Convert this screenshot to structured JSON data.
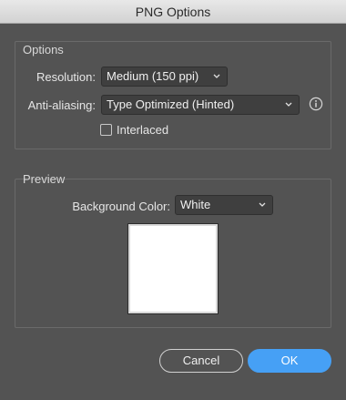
{
  "window": {
    "title": "PNG Options"
  },
  "options_group": {
    "title": "Options",
    "resolution": {
      "label": "Resolution:",
      "value": "Medium (150 ppi)"
    },
    "anti_aliasing": {
      "label": "Anti-aliasing:",
      "value": "Type Optimized (Hinted)"
    },
    "interlaced": {
      "label": "Interlaced",
      "checked": false
    },
    "info_icon": "info-circle-icon"
  },
  "preview_group": {
    "title": "Preview",
    "background_color": {
      "label": "Background Color:",
      "value": "White"
    },
    "swatch_color": "#ffffff"
  },
  "buttons": {
    "cancel_label": "Cancel",
    "ok_label": "OK"
  },
  "colors": {
    "background": "#535353",
    "accent": "#46a0f5"
  }
}
